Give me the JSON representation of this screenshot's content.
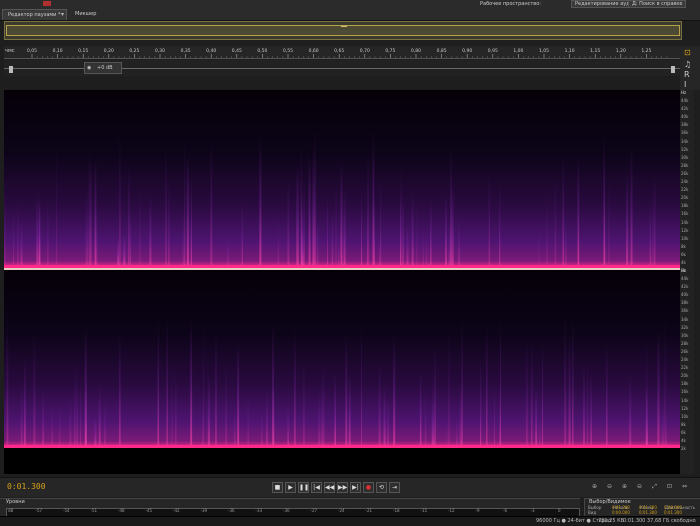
{
  "topbar": {
    "workspace_label": "Рабочее пространство:",
    "workspace_value": "Редактирование ауд...",
    "search_placeholder": "Д: Поиск в справке"
  },
  "tabs": [
    {
      "label": "Редактор паузами *",
      "active": true
    },
    {
      "label": "Микшер",
      "active": false
    }
  ],
  "ruler": {
    "unit": "чмс",
    "ticks": [
      "0,05",
      "0,10",
      "0,15",
      "0,20",
      "0,25",
      "0,30",
      "0,35",
      "0,40",
      "0,45",
      "0,50",
      "0,55",
      "0,60",
      "0,65",
      "0,70",
      "0,75",
      "0,80",
      "0,85",
      "0,90",
      "0,95",
      "1,00",
      "1,05",
      "1,10",
      "1,15",
      "1,20",
      "1,25"
    ]
  },
  "volume": {
    "value": "+0 dB"
  },
  "hz_scale": {
    "unit": "Hz",
    "channel_labels": [
      "44k",
      "42k",
      "40k",
      "38k",
      "36k",
      "34k",
      "32k",
      "30k",
      "28k",
      "26k",
      "24k",
      "22k",
      "20k",
      "18k",
      "16k",
      "14k",
      "12k",
      "10k",
      "8k",
      "6k",
      "4k",
      "2k"
    ]
  },
  "transport": {
    "timecode": "0:01.300",
    "buttons": [
      "stop",
      "play",
      "pause",
      "go-to-start",
      "rewind",
      "fast-forward",
      "go-to-end",
      "record",
      "loop",
      "skip-selection"
    ]
  },
  "levels": {
    "title": "Уровни",
    "scale": [
      "dB",
      "-57",
      "-54",
      "-51",
      "-48",
      "-45",
      "-42",
      "-39",
      "-36",
      "-33",
      "-30",
      "-27",
      "-24",
      "-21",
      "-18",
      "-15",
      "-12",
      "-9",
      "-6",
      "-3",
      "0"
    ]
  },
  "selection_panel": {
    "title": "Выбор/Видимое",
    "headers": [
      "Начало",
      "Конец",
      "Длительность"
    ],
    "rows": [
      {
        "label": "Выбор",
        "start": "0:01.300",
        "end": "0:01.300",
        "duration": "0:00.000"
      },
      {
        "label": "Вид",
        "start": "0:00.000",
        "end": "0:01.300",
        "duration": "0:01.300"
      }
    ]
  },
  "status_bar": {
    "format": "96000 Гц ● 24-бит ● Стерео",
    "size": "731,25 КБ",
    "duration": "0:01.300",
    "free": "37,68 ГБ свободно"
  },
  "colors": {
    "accent": "#d4a017",
    "spectrogram_high": "#ff2a8a",
    "spectrogram_mid": "#6a1a8a",
    "spectrogram_low": "#0a0010"
  }
}
